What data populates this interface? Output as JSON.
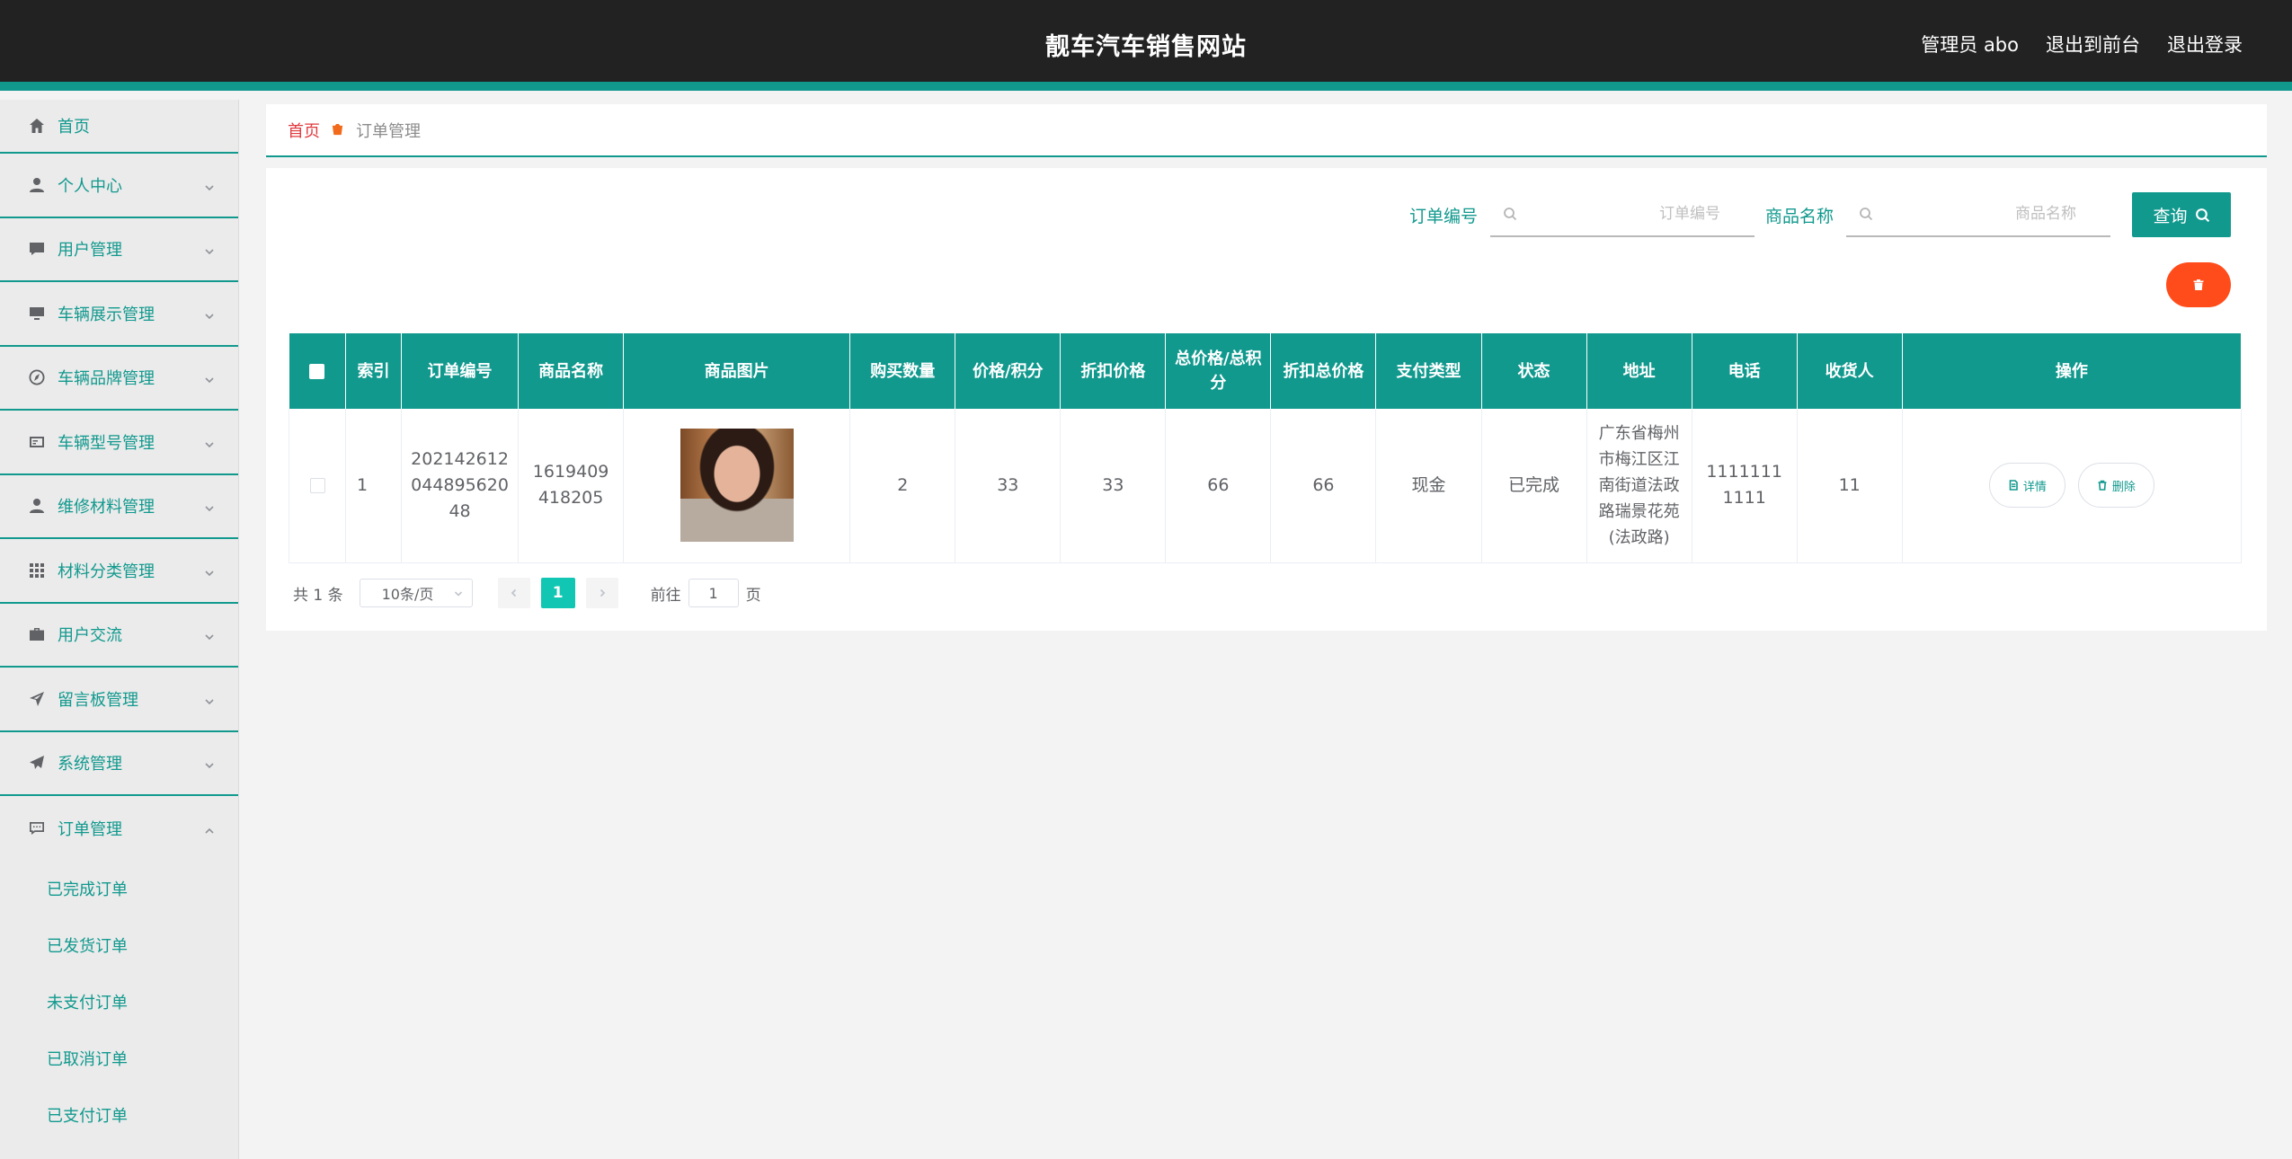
{
  "header": {
    "site_title": "靓车汽车销售网站",
    "admin_label": "管理员 abo",
    "to_front": "退出到前台",
    "logout": "退出登录"
  },
  "sidebar": {
    "items": [
      {
        "label": "首页",
        "icon": "home-icon"
      },
      {
        "label": "个人中心",
        "icon": "user-icon"
      },
      {
        "label": "用户管理",
        "icon": "chat-icon"
      },
      {
        "label": "车辆展示管理",
        "icon": "monitor-icon"
      },
      {
        "label": "车辆品牌管理",
        "icon": "compass-icon"
      },
      {
        "label": "车辆型号管理",
        "icon": "card-icon"
      },
      {
        "label": "维修材料管理",
        "icon": "user-icon"
      },
      {
        "label": "材料分类管理",
        "icon": "grid-icon"
      },
      {
        "label": "用户交流",
        "icon": "briefcase-icon"
      },
      {
        "label": "留言板管理",
        "icon": "navigation-icon"
      },
      {
        "label": "系统管理",
        "icon": "send-icon"
      },
      {
        "label": "订单管理",
        "icon": "message-icon"
      }
    ],
    "submenu": [
      "已完成订单",
      "已发货订单",
      "未支付订单",
      "已取消订单",
      "已支付订单"
    ]
  },
  "breadcrumb": {
    "home": "首页",
    "current": "订单管理"
  },
  "search": {
    "order_no_label": "订单编号",
    "order_no_placeholder": "订单编号",
    "product_label": "商品名称",
    "product_placeholder": "商品名称",
    "query_label": "查询"
  },
  "table": {
    "headers": [
      "索引",
      "订单编号",
      "商品名称",
      "商品图片",
      "购买数量",
      "价格/积分",
      "折扣价格",
      "总价格/总积分",
      "折扣总价格",
      "支付类型",
      "状态",
      "地址",
      "电话",
      "收货人",
      "操作"
    ],
    "rows": [
      {
        "index": "1",
        "order_no": "202142612044895620 48",
        "product_name": "1619409418205",
        "quantity": "2",
        "price": "33",
        "discount_price": "33",
        "total_price": "66",
        "discount_total": "66",
        "pay_type": "现金",
        "status": "已完成",
        "address": "广东省梅州市梅江区江南街道法政路瑞景花苑(法政路)",
        "phone": "11111111111",
        "receiver": "11",
        "detail_label": "详情",
        "delete_label": "删除"
      }
    ]
  },
  "pagination": {
    "total": "共 1 条",
    "page_size": "10条/页",
    "current_page": "1",
    "goto_prefix": "前往",
    "goto_value": "1",
    "goto_suffix": "页"
  },
  "colors": {
    "accent": "#11998e",
    "header_bg": "#222222",
    "danger": "#ff4c1a",
    "breadcrumb_home": "#e0393e"
  }
}
